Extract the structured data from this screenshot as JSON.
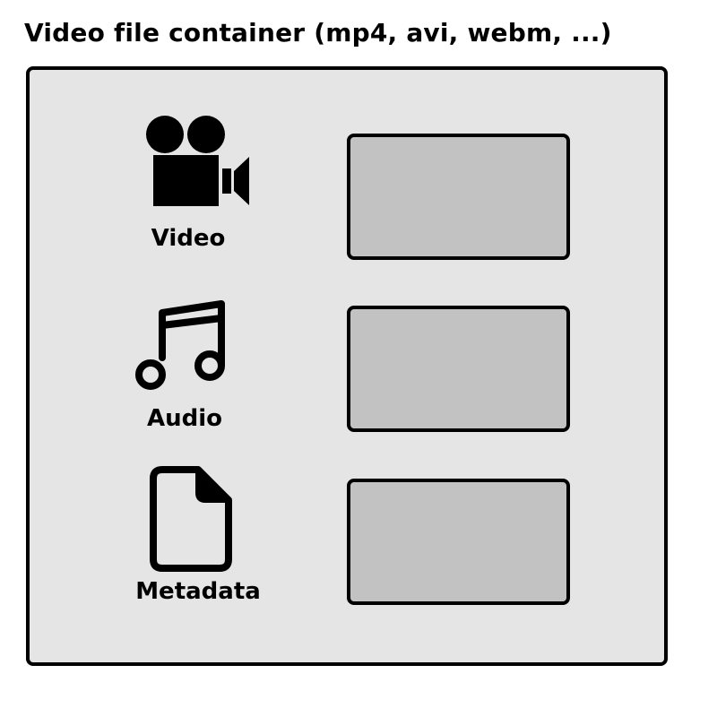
{
  "title": "Video file container (mp4, avi, webm, ...)",
  "colors": {
    "container_fill": "#e5e5e5",
    "slot_fill": "#c2c2c2",
    "stroke": "#000000"
  },
  "streams": [
    {
      "label": "Video",
      "icon": "video-camera-icon"
    },
    {
      "label": "Audio",
      "icon": "music-note-icon"
    },
    {
      "label": "Metadata",
      "icon": "document-icon"
    }
  ]
}
